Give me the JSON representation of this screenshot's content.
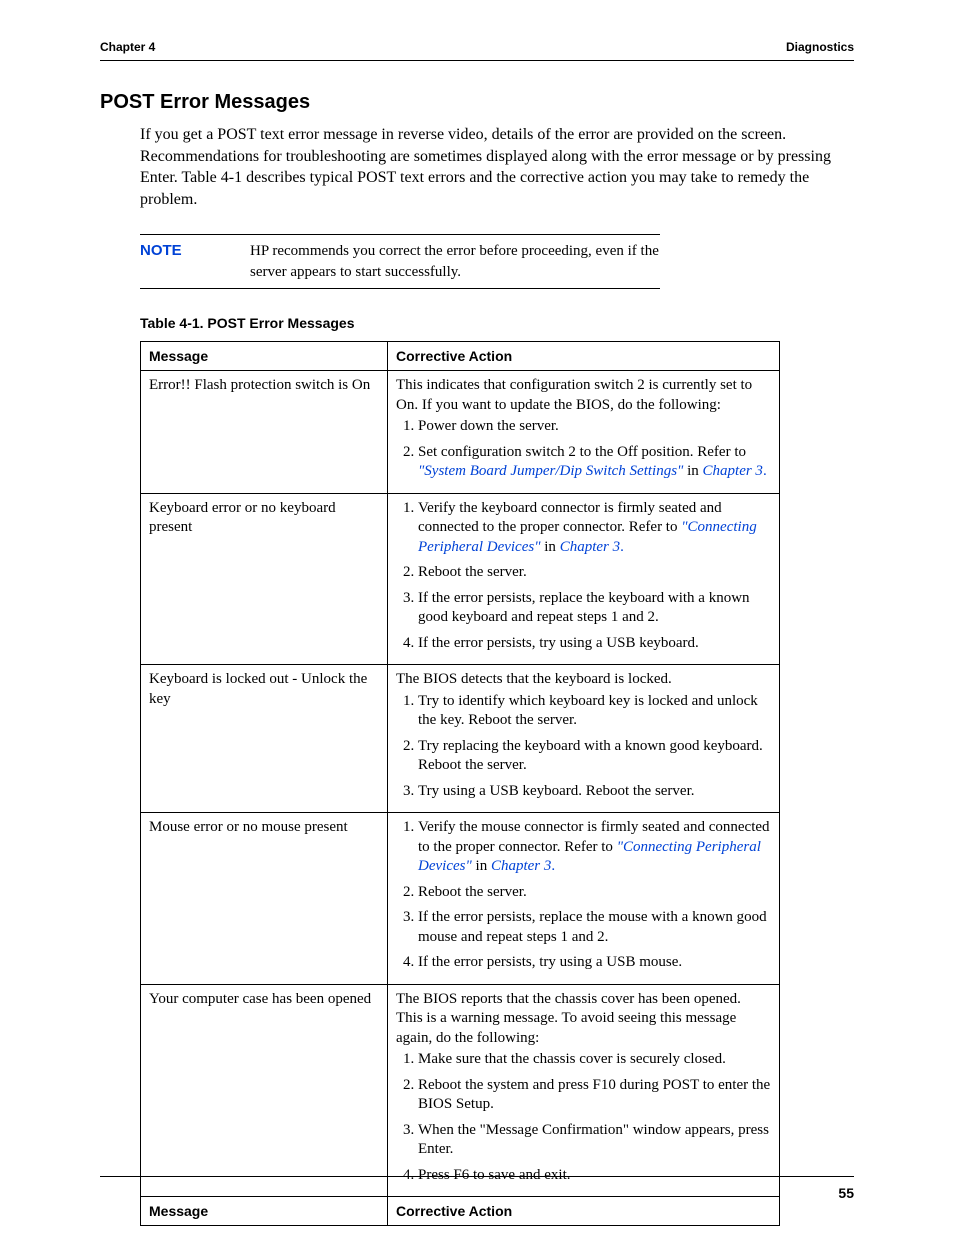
{
  "header": {
    "left": "Chapter 4",
    "right": "Diagnostics"
  },
  "title": "POST Error Messages",
  "intro": "If you get a POST text error message in reverse video, details of the error are provided on the screen. Recommendations for troubleshooting are sometimes displayed along with the error message or by pressing Enter. Table 4-1 describes typical POST text errors and the corrective action you may take to remedy the problem.",
  "note": {
    "label": "NOTE",
    "text": "HP recommends you correct the error before proceeding, even if the server appears to start successfully."
  },
  "table": {
    "caption": "Table 4-1.  POST Error Messages",
    "head": {
      "c1": "Message",
      "c2": "Corrective Action"
    },
    "foot": {
      "c1": "Message",
      "c2": "Corrective Action"
    },
    "rows": {
      "r1": {
        "msg": "Error!! Flash protection switch is On",
        "lead": "This indicates that configuration switch 2 is currently set to On. If you want to update the BIOS, do the following:",
        "s1": "Power down the server.",
        "s2a": "Set configuration switch 2 to the Off position. Refer to ",
        "s2link": "\"System Board Jumper/Dip Switch Settings\"",
        "s2b": " in ",
        "s2chap": "Chapter 3",
        "s2c": "."
      },
      "r2": {
        "msg": "Keyboard error or no keyboard present",
        "s1a": "Verify the keyboard connector is firmly seated and connected to the proper connector. Refer to ",
        "s1link": "\"Connecting Peripheral Devices\"",
        "s1b": "  in ",
        "s1chap": "Chapter 3",
        "s1c": ".",
        "s2": "Reboot the server.",
        "s3": "If the error persists, replace the keyboard with a known good keyboard and repeat steps 1 and 2.",
        "s4": "If the error persists, try using a USB keyboard."
      },
      "r3": {
        "msg": "Keyboard is locked out - Unlock the key",
        "lead": "The BIOS detects that the keyboard is locked.",
        "s1": "Try to identify which keyboard key is locked and unlock the key. Reboot the server.",
        "s2": "Try replacing the keyboard with a known good keyboard. Reboot the server.",
        "s3": "Try using a USB keyboard. Reboot the server."
      },
      "r4": {
        "msg": "Mouse error or no mouse present",
        "s1a": "Verify the mouse connector is firmly seated and connected to the proper connector. Refer to ",
        "s1link": "\"Connecting Peripheral Devices\"",
        "s1b": "  in ",
        "s1chap": "Chapter 3",
        "s1c": ".",
        "s2": "Reboot the server.",
        "s3": "If the error persists, replace the mouse with a known good mouse and repeat steps 1 and 2.",
        "s4": "If the error persists, try using a USB mouse."
      },
      "r5": {
        "msg": "Your computer case has been opened",
        "lead": "The BIOS reports that the chassis cover has been opened. This is a warning message. To avoid seeing this message again, do the following:",
        "s1": "Make sure that the chassis cover is securely closed.",
        "s2": "Reboot the system and press F10 during POST to enter the BIOS Setup.",
        "s3": "When the \"Message Confirmation\" window appears, press Enter.",
        "s4": "Press F6 to save and exit."
      }
    }
  },
  "page_number": "55"
}
